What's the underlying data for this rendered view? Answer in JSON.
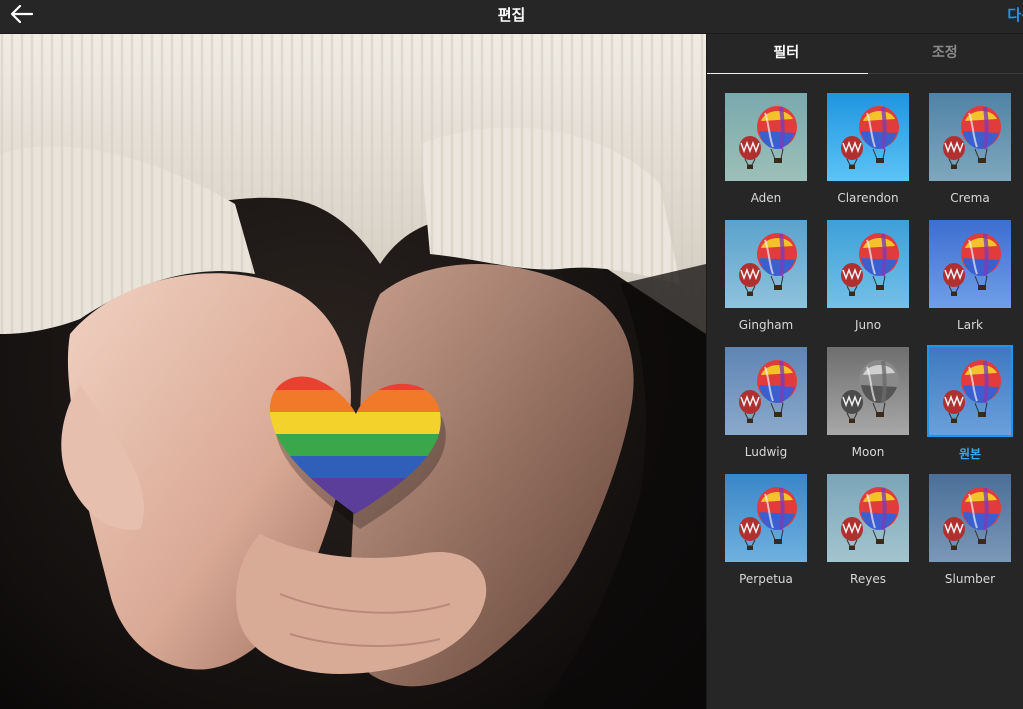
{
  "header": {
    "title": "편집",
    "next_label": "다음",
    "back_icon": "arrow-left-icon"
  },
  "tabs": [
    {
      "label": "필터",
      "active": true
    },
    {
      "label": "조정",
      "active": false
    }
  ],
  "filters": [
    {
      "name": "Aden",
      "bg": [
        "#7aa9ad",
        "#9cc0b8"
      ],
      "tint": "#e0d8c8",
      "selected": false
    },
    {
      "name": "Clarendon",
      "bg": [
        "#1f95e0",
        "#5cc3f5"
      ],
      "tint": "#ffffff",
      "selected": false
    },
    {
      "name": "Crema",
      "bg": [
        "#4f83a6",
        "#7fa7bd"
      ],
      "tint": "#d8d0c0",
      "selected": false
    },
    {
      "name": "Gingham",
      "bg": [
        "#5aa3cc",
        "#8fc2dd"
      ],
      "tint": "#e8e4dc",
      "selected": false
    },
    {
      "name": "Juno",
      "bg": [
        "#3da0d8",
        "#74c0e8"
      ],
      "tint": "#ffffff",
      "selected": false
    },
    {
      "name": "Lark",
      "bg": [
        "#3d6ed0",
        "#6f9fe8"
      ],
      "tint": "#ffffff",
      "selected": false
    },
    {
      "name": "Ludwig",
      "bg": [
        "#5f85b3",
        "#8aa9cc"
      ],
      "tint": "#dcdcdc",
      "selected": false
    },
    {
      "name": "Moon",
      "bg": [
        "#6e6e6e",
        "#a8a8a8"
      ],
      "tint": "#bcbcbc",
      "selected": false,
      "grayscale": true
    },
    {
      "name": "원본",
      "bg": [
        "#3f78c0",
        "#6aa0db"
      ],
      "tint": "#ffffff",
      "selected": true
    },
    {
      "name": "Perpetua",
      "bg": [
        "#3a86c8",
        "#6fb1e0"
      ],
      "tint": "#ffffff",
      "selected": false
    },
    {
      "name": "Reyes",
      "bg": [
        "#7aa5b8",
        "#a3c4cf"
      ],
      "tint": "#e8e2d8",
      "selected": false
    },
    {
      "name": "Slumber",
      "bg": [
        "#4a6f98",
        "#7b98b8"
      ],
      "tint": "#d6cfc4",
      "selected": false
    }
  ],
  "colors": {
    "accent": "#1e96f0",
    "background": "#262626"
  }
}
